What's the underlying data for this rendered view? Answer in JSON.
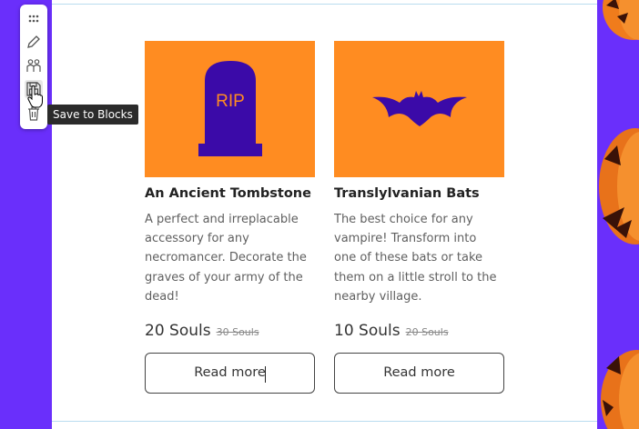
{
  "toolbar": {
    "tools": [
      {
        "icon": "drag-handle-icon"
      },
      {
        "icon": "pencil-icon"
      },
      {
        "icon": "people-icon"
      },
      {
        "icon": "save-icon"
      },
      {
        "icon": "trash-icon"
      }
    ],
    "tooltip": "Save to Blocks"
  },
  "products": [
    {
      "image_text": "RIP",
      "title": "An Ancient Tombstone",
      "description": "A perfect and irreplacable accessory for any necromancer. Decorate the graves of your army of the dead!",
      "price": "20 Souls",
      "old_price": "30 Souls",
      "button": "Read more"
    },
    {
      "title": "Translylvanian Bats",
      "description": "The best choice for any vampire! Transform into one of these bats or take them on a little stroll to the nearby village.",
      "price": "10 Souls",
      "old_price": "20 Souls",
      "button": "Read more"
    }
  ],
  "colors": {
    "background": "#6a2ffb",
    "accent_orange": "#ff8c21",
    "image_purple": "#3b0aa8"
  }
}
